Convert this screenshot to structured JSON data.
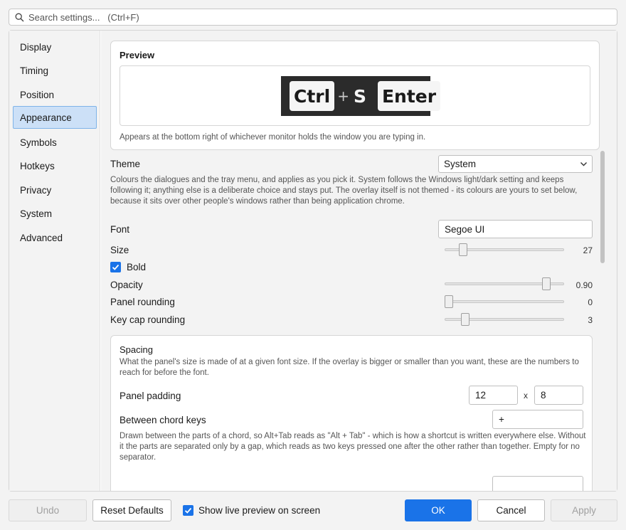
{
  "search": {
    "placeholder": "Search settings...   (Ctrl+F)"
  },
  "sidebar": {
    "items": [
      {
        "label": "Display"
      },
      {
        "label": "Timing"
      },
      {
        "label": "Position"
      },
      {
        "label": "Appearance",
        "active": true
      },
      {
        "label": "Symbols"
      },
      {
        "label": "Hotkeys"
      },
      {
        "label": "Privacy"
      },
      {
        "label": "System"
      },
      {
        "label": "Advanced"
      }
    ]
  },
  "preview": {
    "title": "Preview",
    "keys": {
      "ctrl": "Ctrl",
      "plus": "+",
      "s": "S",
      "enter": "Enter"
    },
    "caption": "Appears at the bottom right of whichever monitor holds the window you are typing in."
  },
  "theme": {
    "label": "Theme",
    "value": "System",
    "description": "Colours the dialogues and the tray menu, and applies as you pick it. System follows the Windows light/dark setting and keeps following it; anything else is a deliberate choice and stays put. The overlay itself is not themed - its colours are yours to set below, because it sits over other people's windows rather than being application chrome."
  },
  "font": {
    "label": "Font",
    "value": "Segoe UI"
  },
  "size": {
    "label": "Size",
    "value": "27",
    "level": 0.13
  },
  "bold": {
    "label": "Bold",
    "checked": true
  },
  "opacity": {
    "label": "Opacity",
    "value": "0.90",
    "level": 0.88
  },
  "panel_rounding": {
    "label": "Panel rounding",
    "value": "0",
    "level": 0.0
  },
  "keycap_rounding": {
    "label": "Key cap rounding",
    "value": "3",
    "level": 0.15
  },
  "spacing": {
    "title": "Spacing",
    "description": "What the panel's size is made of at a given font size. If the overlay is bigger or smaller than you want, these are the numbers to reach for before the font.",
    "panel_padding": {
      "label": "Panel padding",
      "x": "12",
      "times": "x",
      "y": "8"
    },
    "between_chord_keys": {
      "label": "Between chord keys",
      "value": "+",
      "description": "Drawn between the parts of a chord, so Alt+Tab reads as \"Alt + Tab\" - which is how a shortcut is written everywhere else. Without it the parts are separated only by a gap, which reads as two keys pressed one after the other rather than together. Empty for no separator."
    }
  },
  "footer": {
    "undo": "Undo",
    "reset_defaults": "Reset Defaults",
    "show_live_preview": "Show live preview on screen",
    "show_live_preview_checked": true,
    "ok": "OK",
    "cancel": "Cancel",
    "apply": "Apply"
  },
  "colors": {
    "accent": "#1a73e8",
    "selection": "#cce0f7",
    "overlay_bg": "#2b2b2b"
  }
}
